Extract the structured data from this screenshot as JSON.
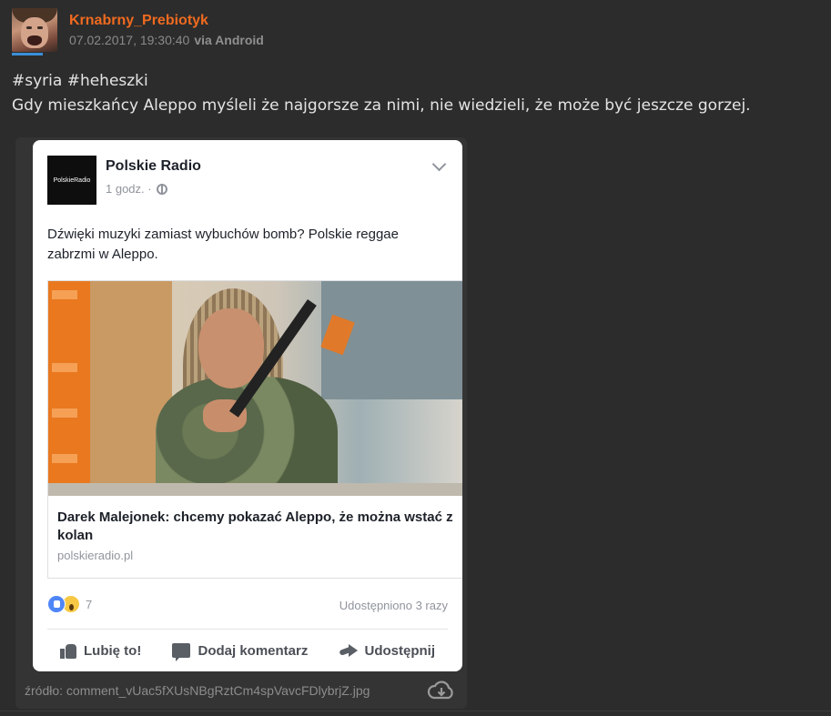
{
  "post": {
    "username": "Krnabrny_Prebiotyk",
    "date": "07.02.2017, 19:30:40",
    "via": "via Android",
    "tags": "#syria #heheszki",
    "text": "Gdy mieszkańcy Aleppo myśleli że najgorsze za nimi, nie wiedzieli, że może być jeszcze gorzej."
  },
  "embed": {
    "page_name": "Polskie Radio",
    "logo_text": "PolskieRadio",
    "time": "1 godz. ·",
    "post_text": "Dźwięki muzyki zamiast wybuchów bomb? Polskie reggae zabrzmi w Aleppo.",
    "link_title": "Darek Malejonek: chcemy pokazać Aleppo, że można wstać z kolan",
    "link_domain": "polskieradio.pl",
    "reaction_count": "7",
    "shares": "Udostępniono 3 razy",
    "actions": {
      "like": "Lubię to!",
      "comment": "Dodaj komentarz",
      "share": "Udostępnij"
    }
  },
  "source": "źródło: comment_vUac5fXUsNBgRztCm4spVavcFDlybrjZ.jpg",
  "colors": {
    "background": "#2c2c2c",
    "username": "#ef6a1f",
    "accent": "#3b8fd8"
  }
}
